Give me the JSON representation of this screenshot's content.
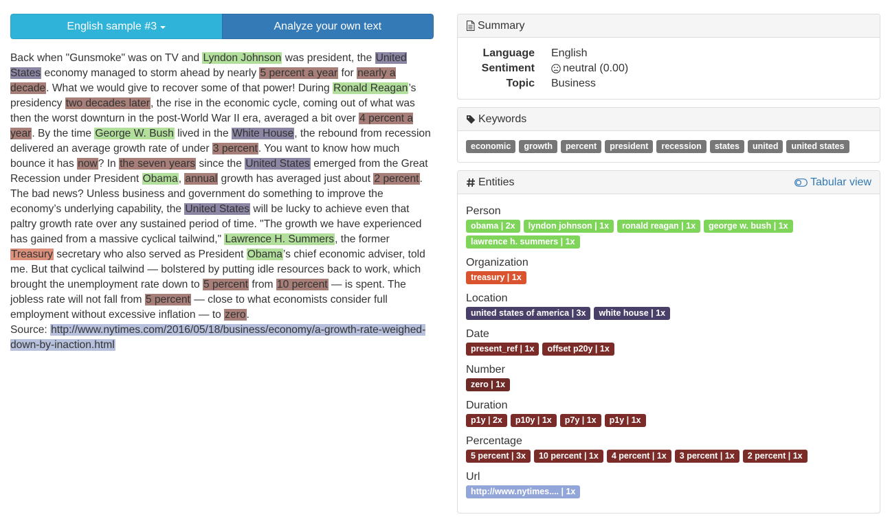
{
  "toolbar": {
    "sample_label": "English sample #3",
    "analyze_label": "Analyze your own text"
  },
  "article": {
    "segments": [
      {
        "text": "Back when \"Gunsmoke\" was on TV and "
      },
      {
        "text": "Lyndon Johnson",
        "type": "person"
      },
      {
        "text": " was president, the "
      },
      {
        "text": "United States",
        "type": "location"
      },
      {
        "text": " economy managed to storm ahead by nearly "
      },
      {
        "text": "5 percent a year",
        "type": "time"
      },
      {
        "text": " for "
      },
      {
        "text": "nearly a decade",
        "type": "time"
      },
      {
        "text": ". What we would give to recover some of that power! During "
      },
      {
        "text": "Ronald Reagan",
        "type": "person"
      },
      {
        "text": "’s presidency "
      },
      {
        "text": "two decades later",
        "type": "time"
      },
      {
        "text": ", the rise in the economic cycle, coming out of what was then the worst downturn in the post-World War II era, averaged a bit over "
      },
      {
        "text": "4 percent a year",
        "type": "time"
      },
      {
        "text": ". By the time "
      },
      {
        "text": "George W. Bush",
        "type": "person"
      },
      {
        "text": " lived in the "
      },
      {
        "text": "White House",
        "type": "location"
      },
      {
        "text": ", the rebound from recession delivered an average growth rate of under "
      },
      {
        "text": "3 percent",
        "type": "time"
      },
      {
        "text": ". You want to know how much bounce it has "
      },
      {
        "text": "now",
        "type": "time"
      },
      {
        "text": "? In "
      },
      {
        "text": "the seven years",
        "type": "time"
      },
      {
        "text": " since the "
      },
      {
        "text": "United States",
        "type": "location"
      },
      {
        "text": " emerged from the Great Recession under President "
      },
      {
        "text": "Obama",
        "type": "person"
      },
      {
        "text": ", "
      },
      {
        "text": "annual",
        "type": "time"
      },
      {
        "text": " growth has averaged just about "
      },
      {
        "text": "2 percent",
        "type": "time"
      },
      {
        "text": ". The bad news? Unless business and government do something to improve the economy’s underlying capability, the "
      },
      {
        "text": "United States",
        "type": "location"
      },
      {
        "text": " will be lucky to achieve even that paltry growth rate over any sustained period of time. \"The growth we have experienced has gained from a massive cyclical tailwind,\" "
      },
      {
        "text": "Lawrence H. Summers",
        "type": "person"
      },
      {
        "text": ", the former "
      },
      {
        "text": "Treasury",
        "type": "org"
      },
      {
        "text": " secretary who also served as President "
      },
      {
        "text": "Obama",
        "type": "person"
      },
      {
        "text": "’s chief economic adviser, told me. But that cyclical tailwind — bolstered by putting idle resources back to work, which brought the unemployment rate down to "
      },
      {
        "text": "5 percent",
        "type": "time"
      },
      {
        "text": " from "
      },
      {
        "text": "10 percent",
        "type": "time"
      },
      {
        "text": " — is spent. The jobless rate will not fall from "
      },
      {
        "text": "5 percent",
        "type": "time"
      },
      {
        "text": " — close to what economists consider full employment without excessive inflation — to "
      },
      {
        "text": "zero",
        "type": "time"
      },
      {
        "text": "."
      }
    ],
    "source_label": "Source: ",
    "source_url": "http://www.nytimes.com/2016/05/18/business/economy/a-growth-rate-weighed-down-by-inaction.html"
  },
  "highlight_colors": {
    "person": "#b2df9b",
    "location": "#8c86a4",
    "time": "#a77e78",
    "org": "#dc8f7b",
    "url": "#b7c1dd"
  },
  "summary": {
    "heading": "Summary",
    "icon": "document-icon",
    "rows": [
      {
        "key": "Language",
        "value": "English"
      },
      {
        "key": "Sentiment",
        "value": "neutral (0.00)",
        "icon": "neutral-face-icon"
      },
      {
        "key": "Topic",
        "value": "Business"
      }
    ]
  },
  "keywords": {
    "heading": "Keywords",
    "icon": "tag-icon",
    "items": [
      "economic",
      "growth",
      "percent",
      "president",
      "recession",
      "states",
      "united",
      "united states"
    ]
  },
  "entities": {
    "heading": "Entities",
    "icon": "hash-icon",
    "tabular_label": "Tabular view",
    "categories": [
      {
        "name": "Person",
        "color": "#7ed55a",
        "labels": [
          "obama | 2x",
          "lyndon johnson | 1x",
          "ronald reagan | 1x",
          "george w. bush | 1x",
          "lawrence h. summers | 1x"
        ]
      },
      {
        "name": "Organization",
        "color": "#d9542e",
        "labels": [
          "treasury | 1x"
        ]
      },
      {
        "name": "Location",
        "color": "#4a3f68",
        "labels": [
          "united states of america | 3x",
          "white house | 1x"
        ]
      },
      {
        "name": "Date",
        "color": "#7b2b28",
        "labels": [
          "present_ref | 1x",
          "offset p20y | 1x"
        ]
      },
      {
        "name": "Number",
        "color": "#6e2a26",
        "labels": [
          "zero | 1x"
        ]
      },
      {
        "name": "Duration",
        "color": "#7b2b28",
        "labels": [
          "p1y | 2x",
          "p10y | 1x",
          "p7y | 1x",
          "p1y | 1x"
        ]
      },
      {
        "name": "Percentage",
        "color": "#7b2b28",
        "labels": [
          "5 percent | 3x",
          "10 percent | 1x",
          "4 percent | 1x",
          "3 percent | 1x",
          "2 percent | 1x"
        ]
      },
      {
        "name": "Url",
        "color": "#93a6d9",
        "labels": [
          "http://www.nytimes.... | 1x"
        ]
      }
    ]
  }
}
